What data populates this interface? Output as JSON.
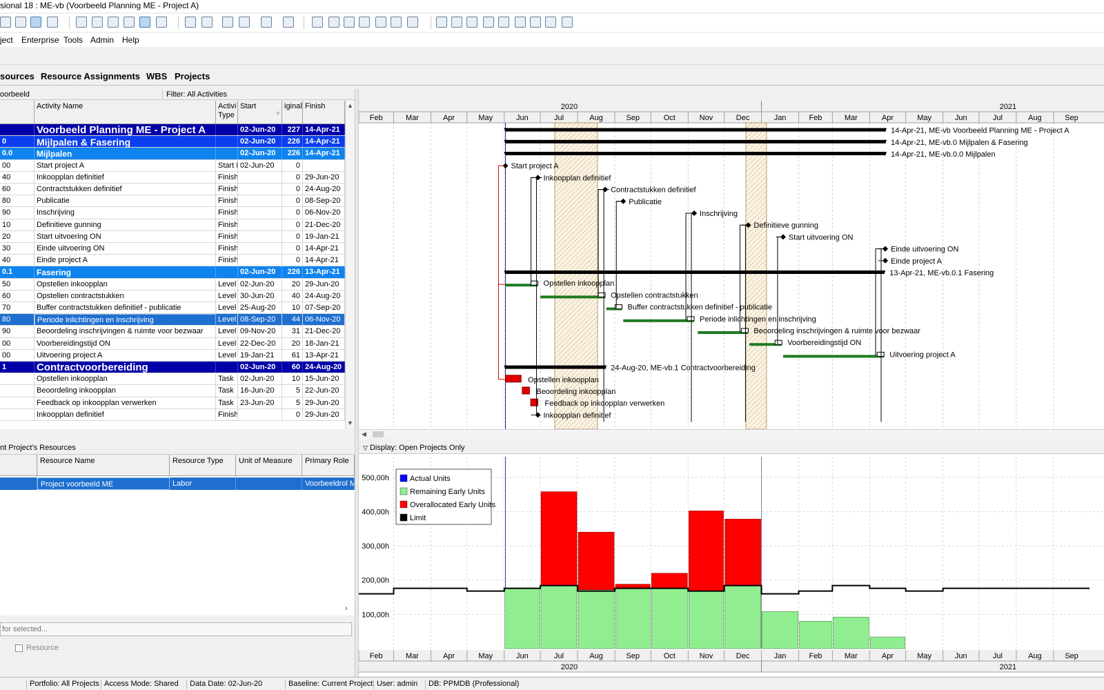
{
  "window": {
    "title": "sional 18 : ME-vb (Voorbeeld Planning ME - Project A)"
  },
  "menu": {
    "items": [
      "ject",
      "Enterprise",
      "Tools",
      "Admin",
      "Help"
    ]
  },
  "tabs": [
    "sources",
    "Resource Assignments",
    "WBS",
    "Projects"
  ],
  "filter": {
    "layout": "oorbeeld",
    "filter": "Filter: All Activities"
  },
  "grid": {
    "columns": {
      "id": "",
      "name": "Activity Name",
      "type": "Activi\nType",
      "start": "Start",
      "dur": "iginal",
      "finish": "Finish"
    },
    "rows": [
      {
        "kind": "wbs1",
        "id": "",
        "name": "Voorbeeld Planning ME - Project A",
        "type": "",
        "start": "02-Jun-20",
        "dur": "227",
        "finish": "14-Apr-21"
      },
      {
        "kind": "wbs2",
        "id": "0",
        "name": "Mijlpalen & Fasering",
        "type": "",
        "start": "02-Jun-20",
        "dur": "226",
        "finish": "14-Apr-21"
      },
      {
        "kind": "wbs3",
        "id": "0.0",
        "name": "Mijlpalen",
        "type": "",
        "start": "02-Jun-20",
        "dur": "226",
        "finish": "14-Apr-21"
      },
      {
        "kind": "act",
        "id": "00",
        "name": "Start project A",
        "type": "Start M",
        "start": "02-Jun-20",
        "dur": "0",
        "finish": ""
      },
      {
        "kind": "act",
        "id": "40",
        "name": "Inkoopplan definitief",
        "type": "Finish",
        "start": "",
        "dur": "0",
        "finish": "29-Jun-20"
      },
      {
        "kind": "act",
        "id": "60",
        "name": "Contractstukken definitief",
        "type": "Finish",
        "start": "",
        "dur": "0",
        "finish": "24-Aug-20"
      },
      {
        "kind": "act",
        "id": "80",
        "name": "Publicatie",
        "type": "Finish",
        "start": "",
        "dur": "0",
        "finish": "08-Sep-20"
      },
      {
        "kind": "act",
        "id": "90",
        "name": "Inschrijving",
        "type": "Finish",
        "start": "",
        "dur": "0",
        "finish": "06-Nov-20"
      },
      {
        "kind": "act",
        "id": "10",
        "name": "Definitieve gunning",
        "type": "Finish",
        "start": "",
        "dur": "0",
        "finish": "21-Dec-20"
      },
      {
        "kind": "act",
        "id": "20",
        "name": "Start uitvoering ON",
        "type": "Finish",
        "start": "",
        "dur": "0",
        "finish": "19-Jan-21"
      },
      {
        "kind": "act",
        "id": "30",
        "name": "Einde uitvoering ON",
        "type": "Finish",
        "start": "",
        "dur": "0",
        "finish": "14-Apr-21"
      },
      {
        "kind": "act",
        "id": "40",
        "name": "Einde project A",
        "type": "Finish",
        "start": "",
        "dur": "0",
        "finish": "14-Apr-21"
      },
      {
        "kind": "wbs3",
        "id": "0.1",
        "name": "Fasering",
        "type": "",
        "start": "02-Jun-20",
        "dur": "226",
        "finish": "13-Apr-21"
      },
      {
        "kind": "act",
        "id": "50",
        "name": "Opstellen inkoopplan",
        "type": "Level",
        "start": "02-Jun-20",
        "dur": "20",
        "finish": "29-Jun-20"
      },
      {
        "kind": "act",
        "id": "60",
        "name": "Opstellen contractstukken",
        "type": "Level",
        "start": "30-Jun-20",
        "dur": "40",
        "finish": "24-Aug-20"
      },
      {
        "kind": "act",
        "id": "70",
        "name": "Buffer contractstukken definitief - publicatie",
        "type": "Level",
        "start": "25-Aug-20",
        "dur": "10",
        "finish": "07-Sep-20"
      },
      {
        "kind": "sel",
        "id": "80",
        "name": "Periode inlichtingen en inschrijving",
        "type": "Level",
        "start": "08-Sep-20",
        "dur": "44",
        "finish": "06-Nov-20"
      },
      {
        "kind": "act",
        "id": "90",
        "name": "Beoordeling inschrijvingen & ruimte voor bezwaar",
        "type": "Level",
        "start": "09-Nov-20",
        "dur": "31",
        "finish": "21-Dec-20"
      },
      {
        "kind": "act",
        "id": "00",
        "name": "Voorbereidingstijd ON",
        "type": "Level",
        "start": "22-Dec-20",
        "dur": "20",
        "finish": "18-Jan-21"
      },
      {
        "kind": "act",
        "id": "00",
        "name": "Uitvoering project A",
        "type": "Level",
        "start": "19-Jan-21",
        "dur": "61",
        "finish": "13-Apr-21"
      },
      {
        "kind": "wbs1b",
        "id": "1",
        "name": "Contractvoorbereiding",
        "type": "",
        "start": "02-Jun-20",
        "dur": "60",
        "finish": "24-Aug-20"
      },
      {
        "kind": "act",
        "id": "",
        "name": "Opstellen inkoopplan",
        "type": "Task",
        "start": "02-Jun-20",
        "dur": "10",
        "finish": "15-Jun-20"
      },
      {
        "kind": "act",
        "id": "",
        "name": "Beoordeling inkoopplan",
        "type": "Task",
        "start": "16-Jun-20",
        "dur": "5",
        "finish": "22-Jun-20"
      },
      {
        "kind": "act",
        "id": "",
        "name": "Feedback op inkoopplan verwerken",
        "type": "Task",
        "start": "23-Jun-20",
        "dur": "5",
        "finish": "29-Jun-20"
      },
      {
        "kind": "act",
        "id": "",
        "name": "Inkoopplan definitief",
        "type": "Finish",
        "start": "",
        "dur": "0",
        "finish": "29-Jun-20"
      }
    ]
  },
  "timescale": {
    "years": [
      {
        "label": "2020",
        "month_index": 5
      },
      {
        "label": "2021",
        "month_index": 17
      }
    ],
    "months": [
      "Feb",
      "Mar",
      "Apr",
      "May",
      "Jun",
      "Jul",
      "Aug",
      "Sep",
      "Oct",
      "Nov",
      "Dec",
      "Jan",
      "Feb",
      "Mar",
      "Apr",
      "May",
      "Jun",
      "Jul",
      "Aug",
      "Sep"
    ]
  },
  "gantt": {
    "summary_labels": [
      "14-Apr-21, ME-vb  Voorbeeld Planning ME - Project A",
      "14-Apr-21, ME-vb.0  Mijlpalen & Fasering",
      "14-Apr-21, ME-vb.0.0  Mijlpalen",
      "13-Apr-21, ME-vb.0.1  Fasering",
      "24-Aug-20, ME-vb.1  Contractvoorbereiding"
    ],
    "bar_labels": [
      "Start project A",
      "Inkoopplan definitief",
      "Contractstukken definitief",
      "Publicatie",
      "Inschrijving",
      "Definitieve gunning",
      "Start uitvoering ON",
      "Einde uitvoering ON",
      "Einde project A",
      "Opstellen inkoopplan",
      "Opstellen contractstukken",
      "Buffer contractstukken definitief - publicatie",
      "Periode inlichtingen en inschrijving",
      "Beoordeling inschrijvingen & ruimte voor bezwaar",
      "Voorbereidingstijd ON",
      "Uitvoering project A",
      "Opstellen inkoopplan",
      "Beoordeling inkoopplan",
      "Feedback op inkoopplan verwerken",
      "Inkoopplan definitief"
    ]
  },
  "resources": {
    "title": "nt Project's Resources",
    "columns": [
      "Resource Name",
      "Resource Type",
      "Unit of Measure",
      "Primary Role"
    ],
    "row": [
      "Project voorbeeld ME",
      "Labor",
      "",
      "Voorbeeldrol ME"
    ],
    "search_placeholder": "for selected...",
    "checkbox_label": "Resource"
  },
  "histogram": {
    "display_label": "Display: Open Projects Only",
    "colors": {
      "actual": "#0000ff",
      "remaining": "#90ee90",
      "overallocated": "#ff0000",
      "limit": "#000000"
    }
  },
  "chart_data": {
    "type": "bar",
    "title": "",
    "xlabel": "",
    "ylabel": "",
    "categories": [
      "Feb",
      "Mar",
      "Apr",
      "May",
      "Jun",
      "Jul",
      "Aug",
      "Sep",
      "Oct",
      "Nov",
      "Dec",
      "Jan",
      "Feb",
      "Mar",
      "Apr",
      "May",
      "Jun",
      "Jul",
      "Aug",
      "Sep"
    ],
    "series": [
      {
        "name": "Actual Units",
        "values": [
          0,
          0,
          0,
          0,
          0,
          0,
          0,
          0,
          0,
          0,
          0,
          0,
          0,
          0,
          0,
          0,
          0,
          0,
          0,
          0
        ]
      },
      {
        "name": "Remaining Early Units",
        "values": [
          0,
          0,
          0,
          0,
          176,
          184,
          172,
          176,
          176,
          168,
          184,
          108,
          80,
          92,
          34,
          0,
          0,
          0,
          0,
          0
        ]
      },
      {
        "name": "Overallocated Early Units",
        "values": [
          0,
          0,
          0,
          0,
          0,
          274,
          168,
          12,
          44,
          234,
          194,
          0,
          0,
          0,
          0,
          0,
          0,
          0,
          0,
          0
        ]
      },
      {
        "name": "Limit",
        "values": [
          160,
          176,
          176,
          168,
          176,
          184,
          168,
          176,
          176,
          168,
          184,
          160,
          168,
          184,
          176,
          168,
          176,
          176,
          176,
          176
        ]
      }
    ],
    "yticks": [
      "100,00h",
      "200,00h",
      "300,00h",
      "400,00h",
      "500,00h"
    ],
    "ylim": [
      0,
      560
    ],
    "legend": "top-left",
    "grid": true
  },
  "status": {
    "portfolio": "Portfolio: All Projects",
    "access": "Access Mode: Shared",
    "data_date": "Data Date: 02-Jun-20",
    "baseline": "Baseline: Current Project",
    "user": "User: admin",
    "db": "DB: PPMDB (Professional)"
  }
}
